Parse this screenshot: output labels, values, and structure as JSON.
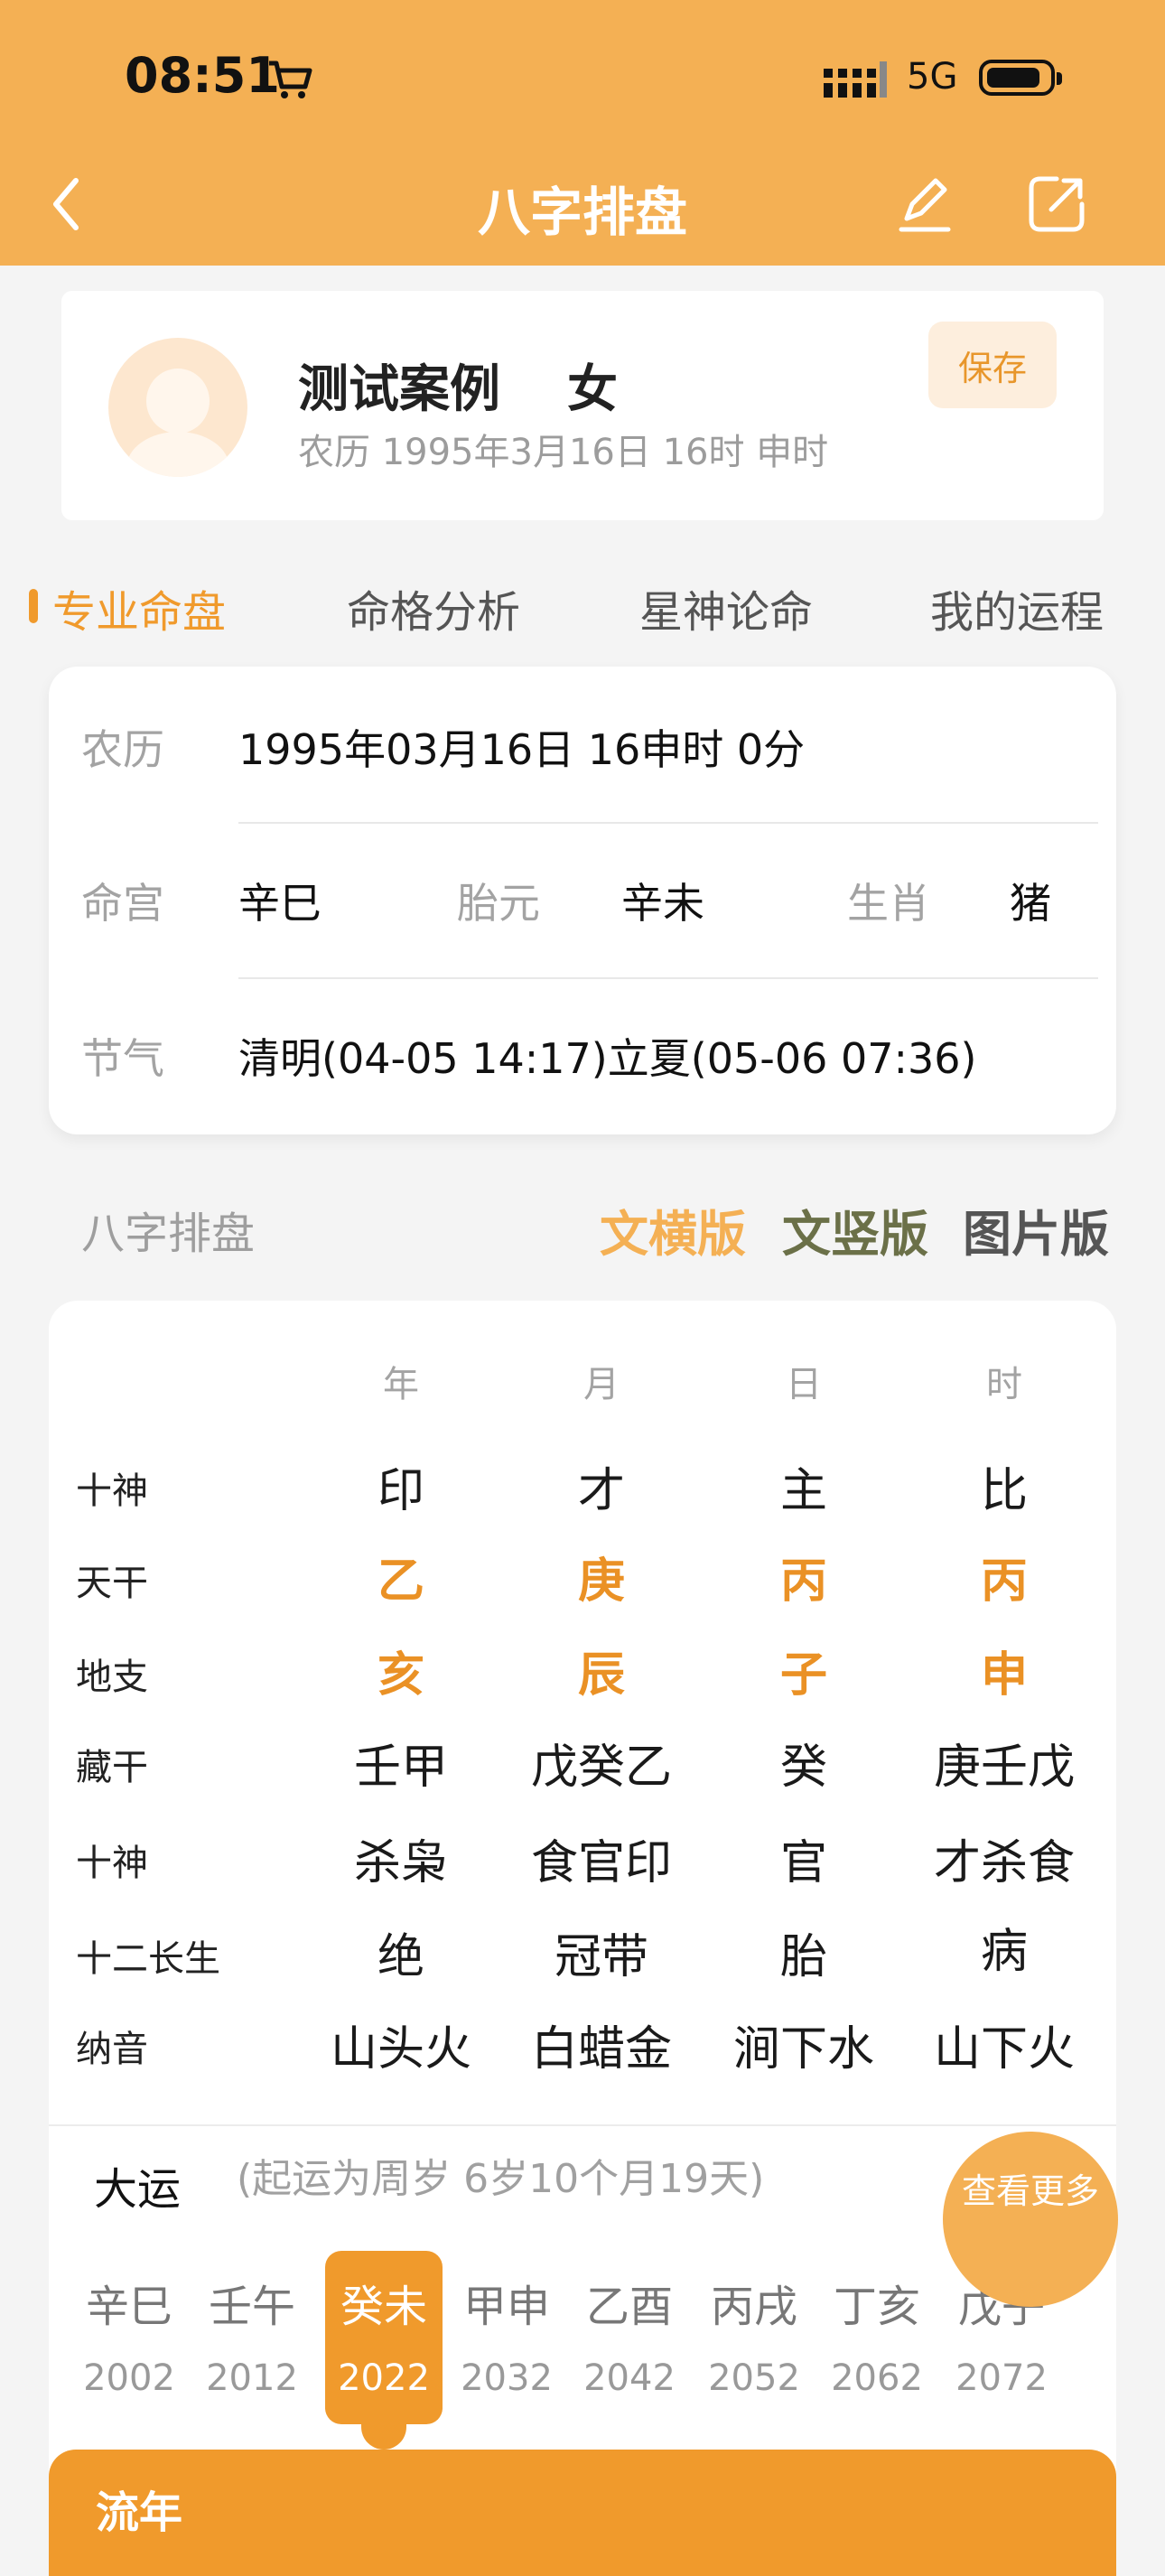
{
  "status_bar": {
    "time": "08:51",
    "network": "5G"
  },
  "header": {
    "title": "八字排盘"
  },
  "profile": {
    "name": "测试案例",
    "gender": "女",
    "date": "农历 1995年3月16日 16时 申时",
    "save_label": "保存"
  },
  "tabs": [
    {
      "label": "专业命盘",
      "active": true
    },
    {
      "label": "命格分析"
    },
    {
      "label": "星神论命"
    },
    {
      "label": "我的运程"
    }
  ],
  "info": {
    "lunar_label": "农历",
    "lunar_value": "1995年03月16日 16申时 0分",
    "minggong_label": "命宫",
    "minggong_value": "辛巳",
    "taiyuan_label": "胎元",
    "taiyuan_value": "辛未",
    "shengxiao_label": "生肖",
    "shengxiao_value": "猪",
    "jieqi_label": "节气",
    "jieqi_value": "清明(04-05 14:17)立夏(05-06 07:36)"
  },
  "section": {
    "title": "八字排盘",
    "versions": [
      "文横版",
      "文竖版",
      "图片版"
    ]
  },
  "bazi": {
    "columns": [
      "年",
      "月",
      "日",
      "时"
    ],
    "rows": [
      {
        "label": "十神",
        "values": [
          "印",
          "才",
          "主",
          "比"
        ]
      },
      {
        "label": "天干",
        "values": [
          "乙",
          "庚",
          "丙",
          "丙"
        ]
      },
      {
        "label": "地支",
        "values": [
          "亥",
          "辰",
          "子",
          "申"
        ]
      },
      {
        "label": "藏干",
        "values": [
          "壬甲",
          "戊癸乙",
          "癸",
          "庚壬戊"
        ]
      },
      {
        "label": "十神",
        "values": [
          "杀枭",
          "食官印",
          "官",
          "才杀食"
        ]
      },
      {
        "label": "十二长生",
        "values": [
          "绝",
          "冠带",
          "胎",
          "病"
        ]
      },
      {
        "label": "纳音",
        "values": [
          "山头火",
          "白蜡金",
          "涧下水",
          "山下火"
        ]
      }
    ]
  },
  "dayun": {
    "label": "大运",
    "note": "(起运为周岁 6岁10个月19天)",
    "more_label": "查看更多",
    "items": [
      {
        "gz": "辛巳",
        "year": "2002"
      },
      {
        "gz": "壬午",
        "year": "2012"
      },
      {
        "gz": "癸未",
        "year": "2022",
        "active": true
      },
      {
        "gz": "甲申",
        "year": "2032"
      },
      {
        "gz": "乙酉",
        "year": "2042"
      },
      {
        "gz": "丙戌",
        "year": "2052"
      },
      {
        "gz": "丁亥",
        "year": "2062"
      },
      {
        "gz": "戊子",
        "year": "2072"
      }
    ]
  },
  "liunian": {
    "label": "流年"
  },
  "colors": {
    "accent": "#f09a2c",
    "header": "#f4b054",
    "ver_green": "#6b7048"
  }
}
